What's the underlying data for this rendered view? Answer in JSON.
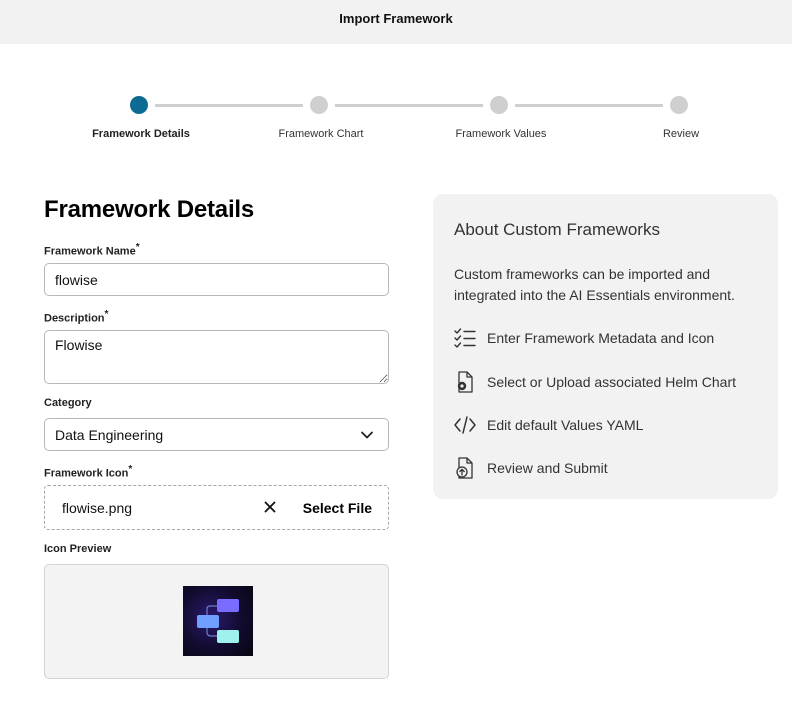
{
  "window": {
    "title": "Import Framework"
  },
  "stepper": {
    "steps": [
      {
        "label": "Framework Details",
        "active": true
      },
      {
        "label": "Framework Chart",
        "active": false
      },
      {
        "label": "Framework Values",
        "active": false
      },
      {
        "label": "Review",
        "active": false
      }
    ],
    "active_color": "#0d6b93",
    "inactive_color": "#cfcfcf"
  },
  "form": {
    "heading": "Framework Details",
    "name": {
      "label": "Framework Name",
      "required": "*",
      "value": "flowise"
    },
    "description": {
      "label": "Description",
      "required": "*",
      "value": "Flowise"
    },
    "category": {
      "label": "Category",
      "value": "Data Engineering"
    },
    "icon": {
      "label": "Framework Icon",
      "required": "*",
      "file_name": "flowise.png",
      "clear_icon": "close-icon",
      "select_label": "Select File"
    },
    "preview": {
      "label": "Icon Preview"
    }
  },
  "about": {
    "title": "About Custom Frameworks",
    "description": "Custom frameworks can be imported and integrated into the AI Essentials environment.",
    "items": [
      {
        "icon": "checklist-icon",
        "label": "Enter Framework Metadata and Icon"
      },
      {
        "icon": "file-settings-icon",
        "label": "Select or Upload associated Helm Chart"
      },
      {
        "icon": "code-icon",
        "label": "Edit default Values YAML"
      },
      {
        "icon": "file-upload-icon",
        "label": "Review and Submit"
      }
    ]
  }
}
